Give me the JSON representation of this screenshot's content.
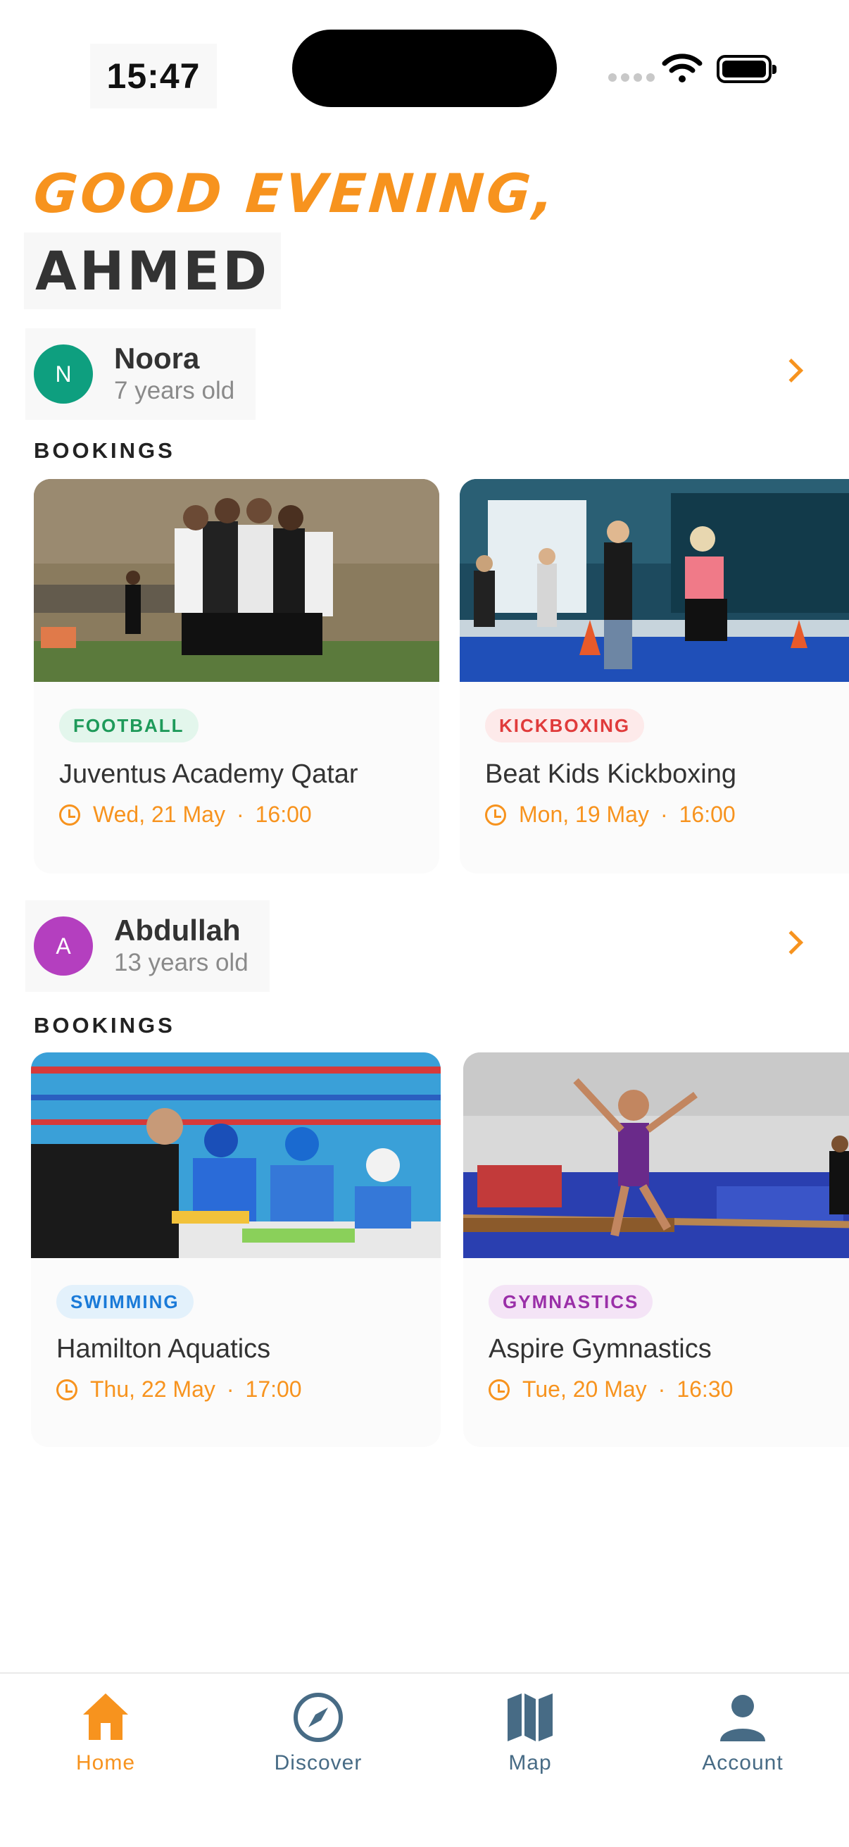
{
  "status_bar": {
    "time": "15:47"
  },
  "greeting": {
    "line1": "GOOD EVENING,",
    "line2": "AHMED"
  },
  "colors": {
    "accent": "#F7931E",
    "nav_inactive": "#476b85"
  },
  "children": [
    {
      "initial": "N",
      "name": "Noora",
      "age": "7 years old",
      "avatar_color": "#0e9f7f",
      "section_label": "BOOKINGS",
      "bookings": [
        {
          "tag": "FOOTBALL",
          "title": "Juventus Academy Qatar",
          "day": "Wed, 21 May",
          "time": "16:00"
        },
        {
          "tag": "KICKBOXING",
          "title": "Beat Kids Kickboxing",
          "day": "Mon, 19 May",
          "time": "16:00"
        }
      ]
    },
    {
      "initial": "A",
      "name": "Abdullah",
      "age": "13 years old",
      "avatar_color": "#b43fbf",
      "section_label": "BOOKINGS",
      "bookings": [
        {
          "tag": "SWIMMING",
          "title": "Hamilton Aquatics",
          "day": "Thu, 22 May",
          "time": "17:00"
        },
        {
          "tag": "GYMNASTICS",
          "title": "Aspire Gymnastics",
          "day": "Tue, 20 May",
          "time": "16:30"
        }
      ]
    }
  ],
  "nav": {
    "home": "Home",
    "discover": "Discover",
    "map": "Map",
    "account": "Account",
    "active": "Home"
  }
}
